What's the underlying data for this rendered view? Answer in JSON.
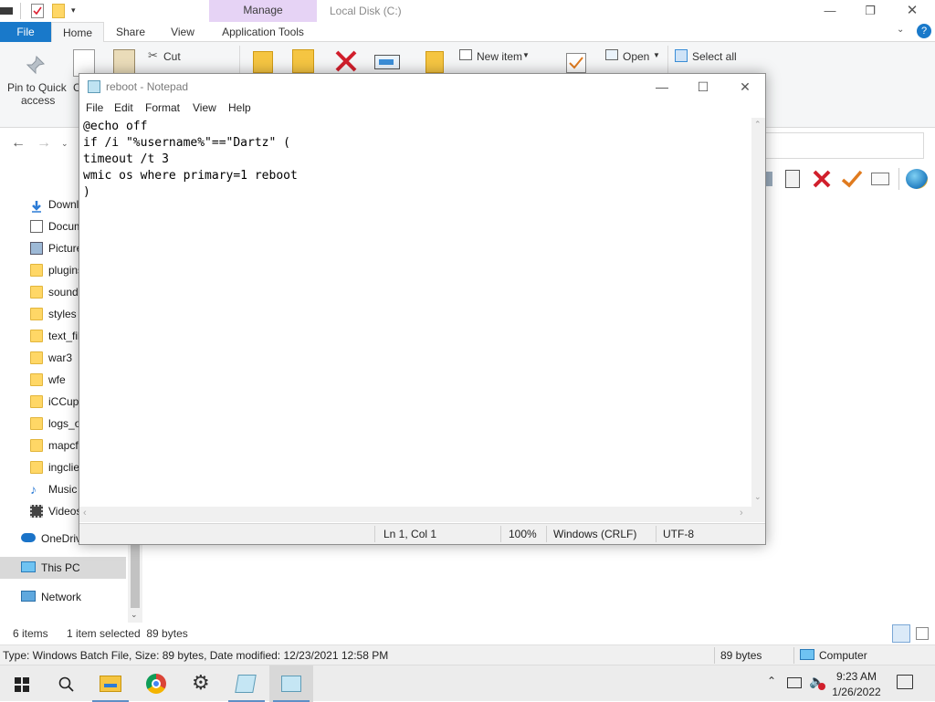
{
  "explorer": {
    "contextual_tab": "Manage",
    "window_title": "Local Disk (C:)",
    "tabs": [
      {
        "label": "File"
      },
      {
        "label": "Home"
      },
      {
        "label": "Share"
      },
      {
        "label": "View"
      },
      {
        "label": "Application Tools"
      }
    ],
    "ribbon": {
      "pin_label_1": "Pin to Quick",
      "pin_label_2": "access",
      "copy_partial": "C",
      "cut_label": "Cut",
      "new_item_label": "New item",
      "open_label": "Open",
      "select_all_label": "Select all"
    },
    "nav_items": [
      {
        "label": "Downloads",
        "icon": "download-icon"
      },
      {
        "label": "Documents",
        "icon": "document-icon"
      },
      {
        "label": "Pictures",
        "icon": "pictures-icon"
      },
      {
        "label": "plugins",
        "icon": "folder-icon"
      },
      {
        "label": "sounds",
        "icon": "folder-icon"
      },
      {
        "label": "styles",
        "icon": "folder-icon"
      },
      {
        "label": "text_files",
        "icon": "folder-icon"
      },
      {
        "label": "war3",
        "icon": "folder-icon"
      },
      {
        "label": "wfe",
        "icon": "folder-icon"
      },
      {
        "label": "iCCup",
        "icon": "folder-icon"
      },
      {
        "label": "logs_old",
        "icon": "folder-icon"
      },
      {
        "label": "mapcfg",
        "icon": "folder-icon"
      },
      {
        "label": "ingclient",
        "icon": "folder-icon"
      },
      {
        "label": "Music",
        "icon": "music-icon"
      },
      {
        "label": "Videos",
        "icon": "videos-icon"
      }
    ],
    "nav_roots": [
      {
        "label": "OneDrive",
        "icon": "onedrive-icon"
      },
      {
        "label": "This PC",
        "icon": "computer-icon"
      },
      {
        "label": "Network",
        "icon": "network-icon"
      }
    ],
    "status": {
      "items_count": "6 items",
      "selected": "1 item selected  89 bytes"
    },
    "details_bar": {
      "info": "Type: Windows Batch File, Size: 89 bytes, Date modified: 12/23/2021 12:58 PM",
      "size": "89 bytes",
      "location": "Computer"
    }
  },
  "notepad": {
    "title": "reboot - Notepad",
    "menu": [
      "File",
      "Edit",
      "Format",
      "View",
      "Help"
    ],
    "lines": [
      "@echo off",
      "if /i \"%username%\"==\"Dartz\" (",
      "timeout /t 3",
      "wmic os where primary=1 reboot",
      ")"
    ],
    "status": {
      "position": "Ln 1, Col 1",
      "zoom": "100%",
      "line_ending": "Windows (CRLF)",
      "encoding": "UTF-8"
    }
  },
  "taskbar": {
    "time": "9:23 AM",
    "date": "1/26/2022"
  },
  "colors": {
    "file_tab": "#1979ca",
    "contextual_tab": "#e6d3f5",
    "taskbar": "#ececec"
  }
}
